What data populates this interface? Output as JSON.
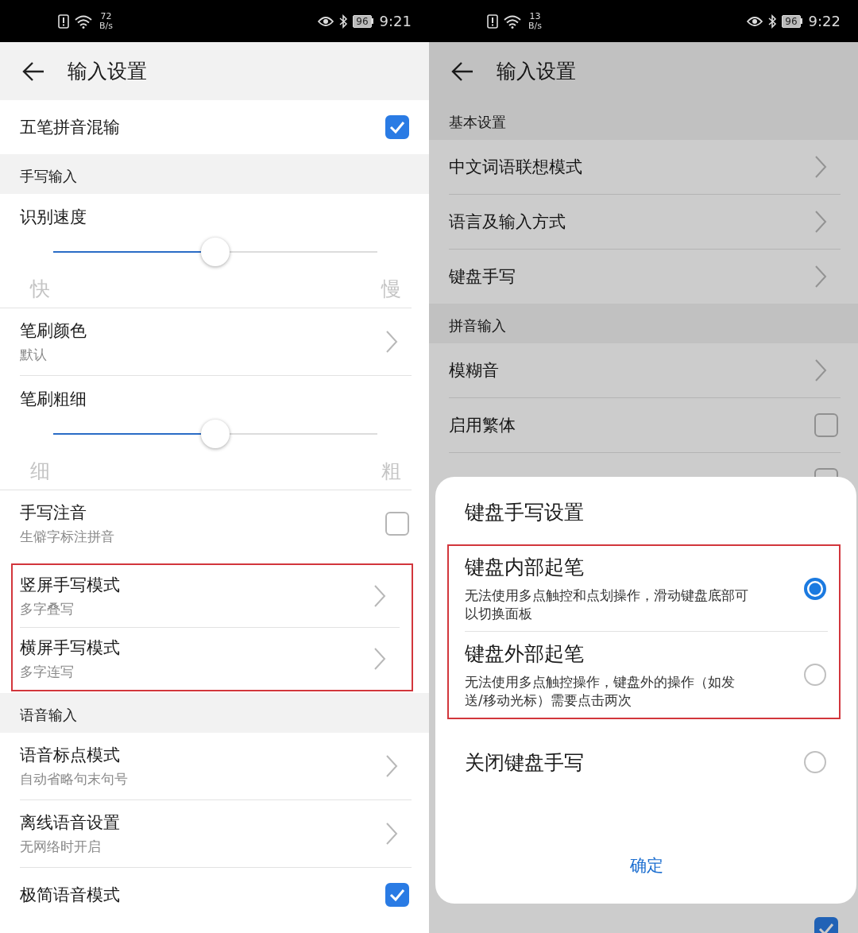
{
  "screens": [
    {
      "status_bar": {
        "speed": "72",
        "speed_unit": "B/s",
        "battery": "96",
        "time": "9:21"
      },
      "title": "输入设置",
      "items": [
        {
          "kind": "checkbox",
          "label": "五笔拼音混输",
          "checked": true,
          "highlighted": false
        },
        {
          "kind": "section",
          "label": "手写输入"
        },
        {
          "kind": "slider",
          "label": "识别速度",
          "level": 0.5,
          "min_label": "快",
          "max_label": "慢",
          "highlighted": false
        },
        {
          "kind": "link",
          "label": "笔刷颜色",
          "subtitle": "默认",
          "highlighted": false
        },
        {
          "kind": "slider",
          "label": "笔刷粗细",
          "level": 0.5,
          "min_label": "细",
          "max_label": "粗",
          "highlighted": false
        },
        {
          "kind": "checkbox",
          "label": "手写注音",
          "subtitle": "生僻字标注拼音",
          "checked": false,
          "highlighted": false
        },
        {
          "kind": "link",
          "label": "竖屏手写模式",
          "subtitle": "多字叠写",
          "highlighted": true
        },
        {
          "kind": "link",
          "label": "横屏手写模式",
          "subtitle": "多字连写",
          "highlighted": true
        },
        {
          "kind": "section",
          "label": "语音输入"
        },
        {
          "kind": "link",
          "label": "语音标点模式",
          "subtitle": "自动省略句末句号",
          "highlighted": false
        },
        {
          "kind": "link",
          "label": "离线语音设置",
          "subtitle": "无网络时开启",
          "highlighted": false
        },
        {
          "kind": "checkbox",
          "label": "极简语音模式",
          "checked": true,
          "highlighted": false
        }
      ]
    },
    {
      "status_bar": {
        "speed": "13",
        "speed_unit": "B/s",
        "battery": "96",
        "time": "9:22"
      },
      "title": "输入设置",
      "items": [
        {
          "kind": "section",
          "label": "基本设置"
        },
        {
          "kind": "link",
          "label": "中文词语联想模式",
          "highlighted": false
        },
        {
          "kind": "link",
          "label": "语言及输入方式",
          "highlighted": false
        },
        {
          "kind": "link",
          "label": "键盘手写",
          "highlighted": false
        },
        {
          "kind": "section",
          "label": "拼音输入"
        },
        {
          "kind": "link",
          "label": "模糊音",
          "highlighted": false
        },
        {
          "kind": "checkbox",
          "label": "启用繁体",
          "checked": false,
          "highlighted": false
        },
        {
          "kind": "checkbox",
          "checked": false,
          "highlighted": false
        }
      ],
      "bottom_items": [
        {
          "kind": "checkbox",
          "checked": true,
          "highlighted": false
        }
      ],
      "dialog": {
        "title": "键盘手写设置",
        "options": [
          {
            "label": "键盘内部起笔",
            "description": "无法使用多点触控和点划操作，滑动键盘底部可以切换面板",
            "selected": true,
            "highlighted": true
          },
          {
            "label": "键盘外部起笔",
            "description": "无法使用多点触控操作，键盘外的操作（如发送/移动光标）需要点击两次",
            "selected": false,
            "highlighted": true
          },
          {
            "label": "关闭键盘手写",
            "selected": false,
            "highlighted": false
          }
        ],
        "button": "确定"
      }
    }
  ]
}
